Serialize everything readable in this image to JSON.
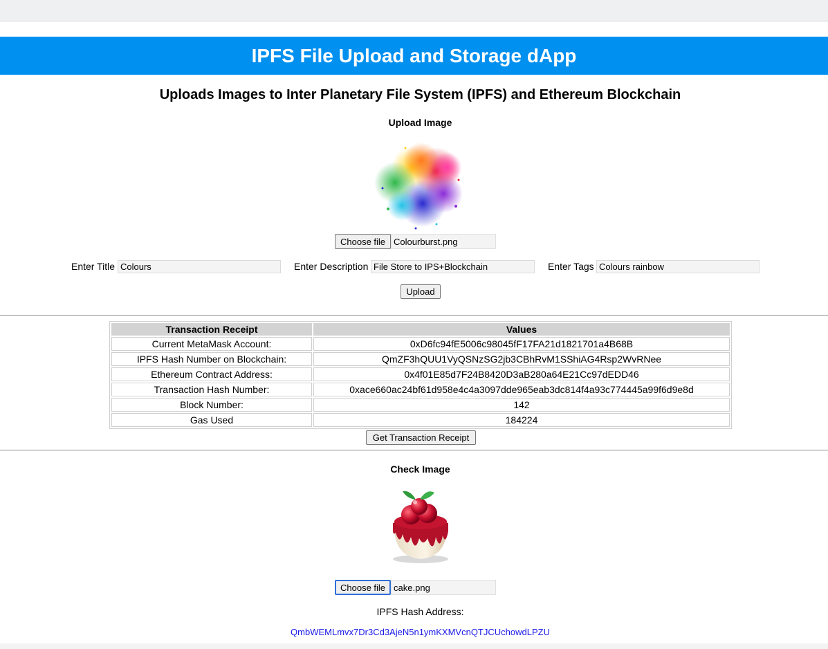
{
  "header": {
    "title": "IPFS File Upload and Storage dApp",
    "subtitle": "Uploads Images to Inter Planetary File System (IPFS) and Ethereum Blockchain",
    "banner_color": "#0090f0"
  },
  "upload": {
    "section_label": "Upload Image",
    "preview_image": "colourburst-paint-splash-image",
    "choose_file_label": "Choose file",
    "file_name": "Colourburst.png",
    "title_label": "Enter Title",
    "title_value": "Colours",
    "description_label": "Enter Description",
    "description_value": "File Store to IPS+Blockchain",
    "tags_label": "Enter Tags",
    "tags_value": "Colours rainbow",
    "upload_button": "Upload"
  },
  "receipt": {
    "headers": [
      "Transaction Receipt",
      "Values"
    ],
    "rows": [
      {
        "label": "Current MetaMask Account:",
        "value": "0xD6fc94fE5006c98045fF17FA21d1821701a4B68B"
      },
      {
        "label": "IPFS Hash Number on Blockchain:",
        "value": "QmZF3hQUU1VyQSNzSG2jb3CBhRvM1SShiAG4Rsp2WvRNee"
      },
      {
        "label": "Ethereum Contract Address:",
        "value": "0x4f01E85d7F24B8420D3aB280a64E21Cc97dEDD46"
      },
      {
        "label": "Transaction Hash Number:",
        "value": "0xace660ac24bf61d958e4c4a3097dde965eab3dc814f4a93c774445a99f6d9e8d"
      },
      {
        "label": "Block Number:",
        "value": "142"
      },
      {
        "label": "Gas Used",
        "value": "184224"
      }
    ],
    "get_receipt_button": "Get Transaction Receipt"
  },
  "check": {
    "section_label": "Check Image",
    "preview_image": "cake-with-cherries-image",
    "choose_file_label": "Choose file",
    "file_name": "cake.png",
    "hash_label": "IPFS Hash Address:",
    "hash_value": "QmbWEMLmvx7Dr3Cd3AjeN5n1ymKXMVcnQTJCUchowdLPZU"
  }
}
